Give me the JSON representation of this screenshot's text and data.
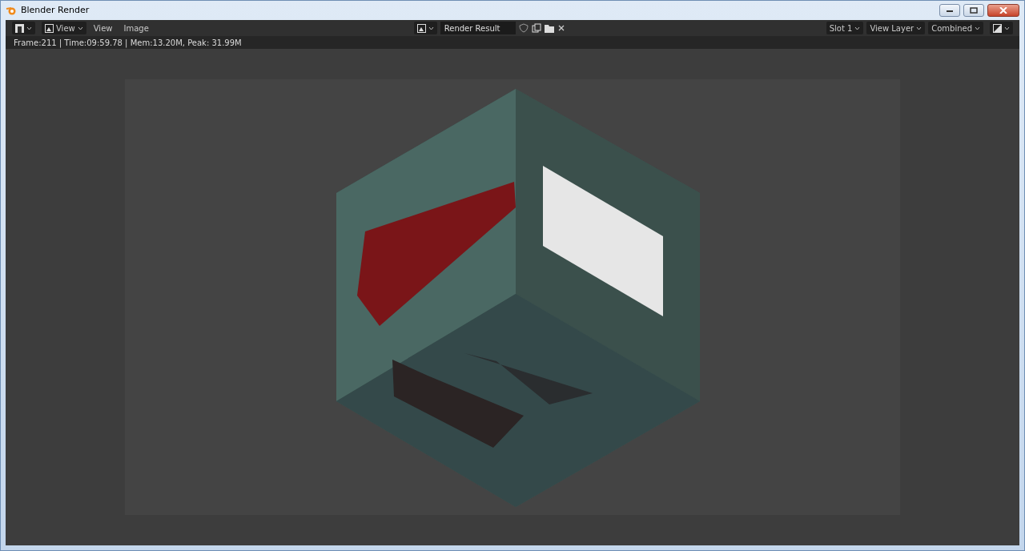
{
  "window": {
    "title": "Blender Render"
  },
  "header": {
    "mode_menu": "View",
    "menus": [
      "View",
      "Image"
    ],
    "image_name": "Render Result",
    "slot": "Slot 1",
    "view_layer": "View Layer",
    "pass": "Combined"
  },
  "status": "Frame:211 | Time:09:59.78 | Mem:13.20M, Peak: 31.99M"
}
